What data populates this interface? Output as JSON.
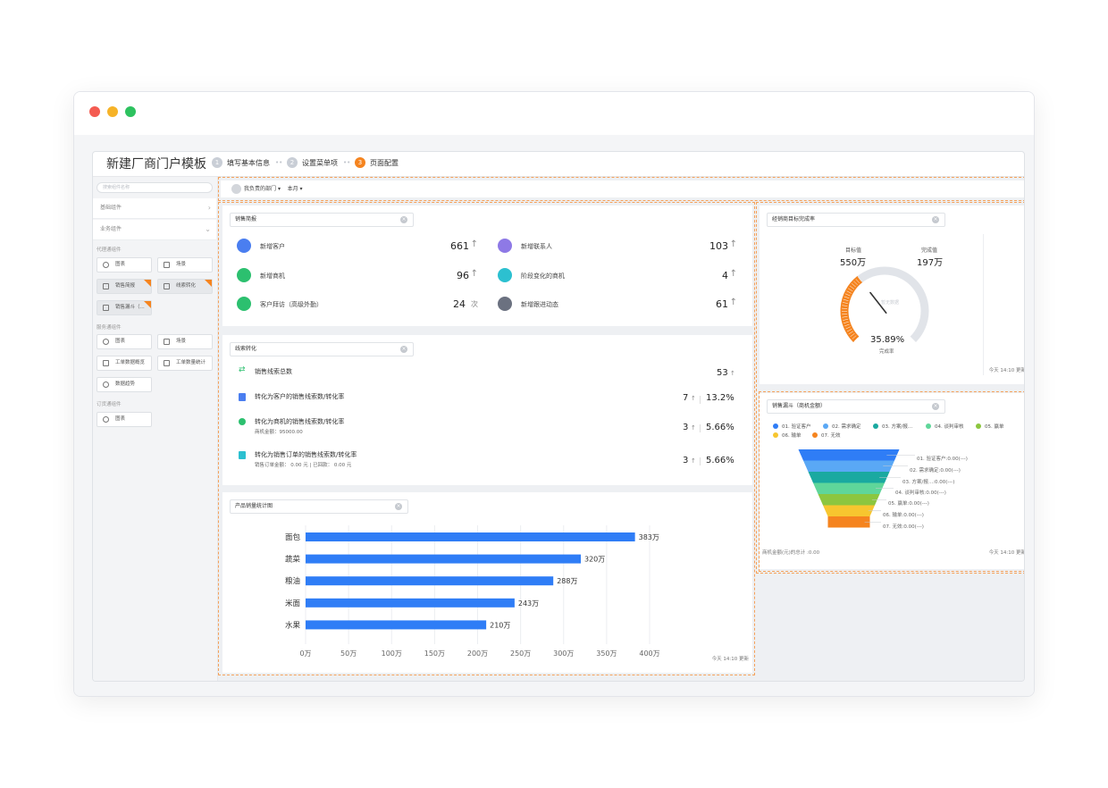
{
  "app": {
    "title": "新建厂商门户模板",
    "steps": [
      {
        "num": "1",
        "label": "填写基本信息"
      },
      {
        "num": "2",
        "label": "设置菜单项"
      },
      {
        "num": "3",
        "label": "页面配置"
      }
    ],
    "step_separator": "••"
  },
  "sidebar": {
    "search_placeholder": "搜索组件名称",
    "sections": [
      {
        "label": "基础组件",
        "chev": "›"
      },
      {
        "label": "业务组件",
        "chev": "⌄"
      }
    ],
    "groups": [
      {
        "label": "代理通组件",
        "items": [
          {
            "label": "图表",
            "icon": "pie-chart-icon"
          },
          {
            "label": "场景",
            "icon": "grid-icon"
          },
          {
            "label": "销售简报",
            "icon": "report-icon",
            "flag": true
          },
          {
            "label": "线索转化",
            "icon": "report-icon",
            "flag": true
          },
          {
            "label": "销售漏斗（...",
            "icon": "funnel-icon",
            "flag": true
          }
        ]
      },
      {
        "label": "服务通组件",
        "items": [
          {
            "label": "图表",
            "icon": "pie-chart-icon"
          },
          {
            "label": "场景",
            "icon": "grid-icon"
          },
          {
            "label": "工单数据概览",
            "icon": "report-icon"
          },
          {
            "label": "工单数量统计",
            "icon": "report-icon"
          },
          {
            "label": "数据趋势",
            "icon": "trend-icon"
          }
        ]
      },
      {
        "label": "订货通组件",
        "items": [
          {
            "label": "图表",
            "icon": "pie-chart-icon"
          }
        ]
      }
    ]
  },
  "filters": {
    "dept": "我负责的部门",
    "period": "本月",
    "caret": "▾"
  },
  "sales_brief": {
    "title": "销售简报",
    "close": "×",
    "items": [
      {
        "label": "新增客户",
        "value": "661",
        "arrow": "↑",
        "color": "#4a7ef0",
        "icon": "customer-icon"
      },
      {
        "label": "新增联系人",
        "value": "103",
        "arrow": "↑",
        "color": "#8e79e6",
        "icon": "contact-icon"
      },
      {
        "label": "新增商机",
        "value": "96",
        "arrow": "↑",
        "color": "#2cc06f",
        "icon": "opportunity-icon"
      },
      {
        "label": "阶段变化的商机",
        "value": "4",
        "arrow": "↑",
        "color": "#2cc0d0",
        "icon": "stage-icon"
      },
      {
        "label": "客户拜访（高级外勤）",
        "value": "24",
        "arrow": "次",
        "color": "#2cc06f",
        "icon": "location-icon"
      },
      {
        "label": "新增跟进动态",
        "value": "61",
        "arrow": "↑",
        "color": "#6b7180",
        "icon": "activity-icon"
      }
    ]
  },
  "lead_conversion": {
    "title": "线索转化",
    "close": "×",
    "rows": [
      {
        "label": "销售线索总数",
        "value": "53",
        "arrow": "↑",
        "color": "#2cc06f"
      },
      {
        "label": "转化为客户的销售线索数/转化率",
        "value": "7",
        "arrow": "↑",
        "pct": "13.2%",
        "color": "#4a7ef0"
      },
      {
        "label": "转化为商机的销售线索数/转化率",
        "value": "3",
        "arrow": "↑",
        "pct": "5.66%",
        "color": "#2cc06f",
        "sub": "商机金额：95000.00"
      },
      {
        "label": "转化为销售订单的销售线索数/转化率",
        "value": "3",
        "arrow": "↑",
        "pct": "5.66%",
        "color": "#2cc0d0",
        "sub": "销售订单金额： 0.00 元  |  已回款： 0.00 元"
      }
    ]
  },
  "product_chart": {
    "title": "产品销量统计图",
    "close": "×",
    "updated": "今天 14:10 更新"
  },
  "chart_data": {
    "type": "bar",
    "orientation": "horizontal",
    "categories": [
      "面包",
      "蔬菜",
      "粮油",
      "米面",
      "水果"
    ],
    "values": [
      383,
      320,
      288,
      243,
      210
    ],
    "value_labels": [
      "383万",
      "320万",
      "288万",
      "243万",
      "210万"
    ],
    "xticks": [
      "0万",
      "50万",
      "100万",
      "150万",
      "200万",
      "250万",
      "300万",
      "350万",
      "400万"
    ],
    "xlim": [
      0,
      400
    ],
    "color": "#2f7df6",
    "grid": true
  },
  "target": {
    "title": "经销商目标完成率",
    "close": "×",
    "target_label": "目标值",
    "target_value": "550万",
    "done_label": "完成值",
    "done_value": "197万",
    "percent": "35.89%",
    "percent_label": "完成率",
    "ratio": 0.3589,
    "watermark": "暂无数据",
    "updated": "今天 14:10 更新",
    "color": "#f5841f"
  },
  "funnel": {
    "title": "销售漏斗（商机金额）",
    "close": "×",
    "stages": [
      {
        "legend": "01. 验证客户",
        "label": "01. 验证客户:0.00(---)",
        "color": "#2f7df6"
      },
      {
        "legend": "02. 需求确定",
        "label": "02. 需求确定:0.00(---)",
        "color": "#5aa8f5"
      },
      {
        "legend": "03. 方案/报...",
        "label": "03. 方案/报...:0.00(---)",
        "color": "#1aa9a0"
      },
      {
        "legend": "04. 谈判审核",
        "label": "04. 谈判审核:0.00(---)",
        "color": "#5fd69a"
      },
      {
        "legend": "05. 赢单",
        "label": "05. 赢单:0.00(---)",
        "color": "#8cc63f"
      },
      {
        "legend": "06. 输单",
        "label": "06. 输单:0.00(---)",
        "color": "#f7c62f"
      },
      {
        "legend": "07. 无效",
        "label": "07. 无效:0.00(---)",
        "color": "#f5841f"
      }
    ],
    "footer": "商机金额(元)的总计 :0.00",
    "updated": "今天 14:10 更新"
  }
}
